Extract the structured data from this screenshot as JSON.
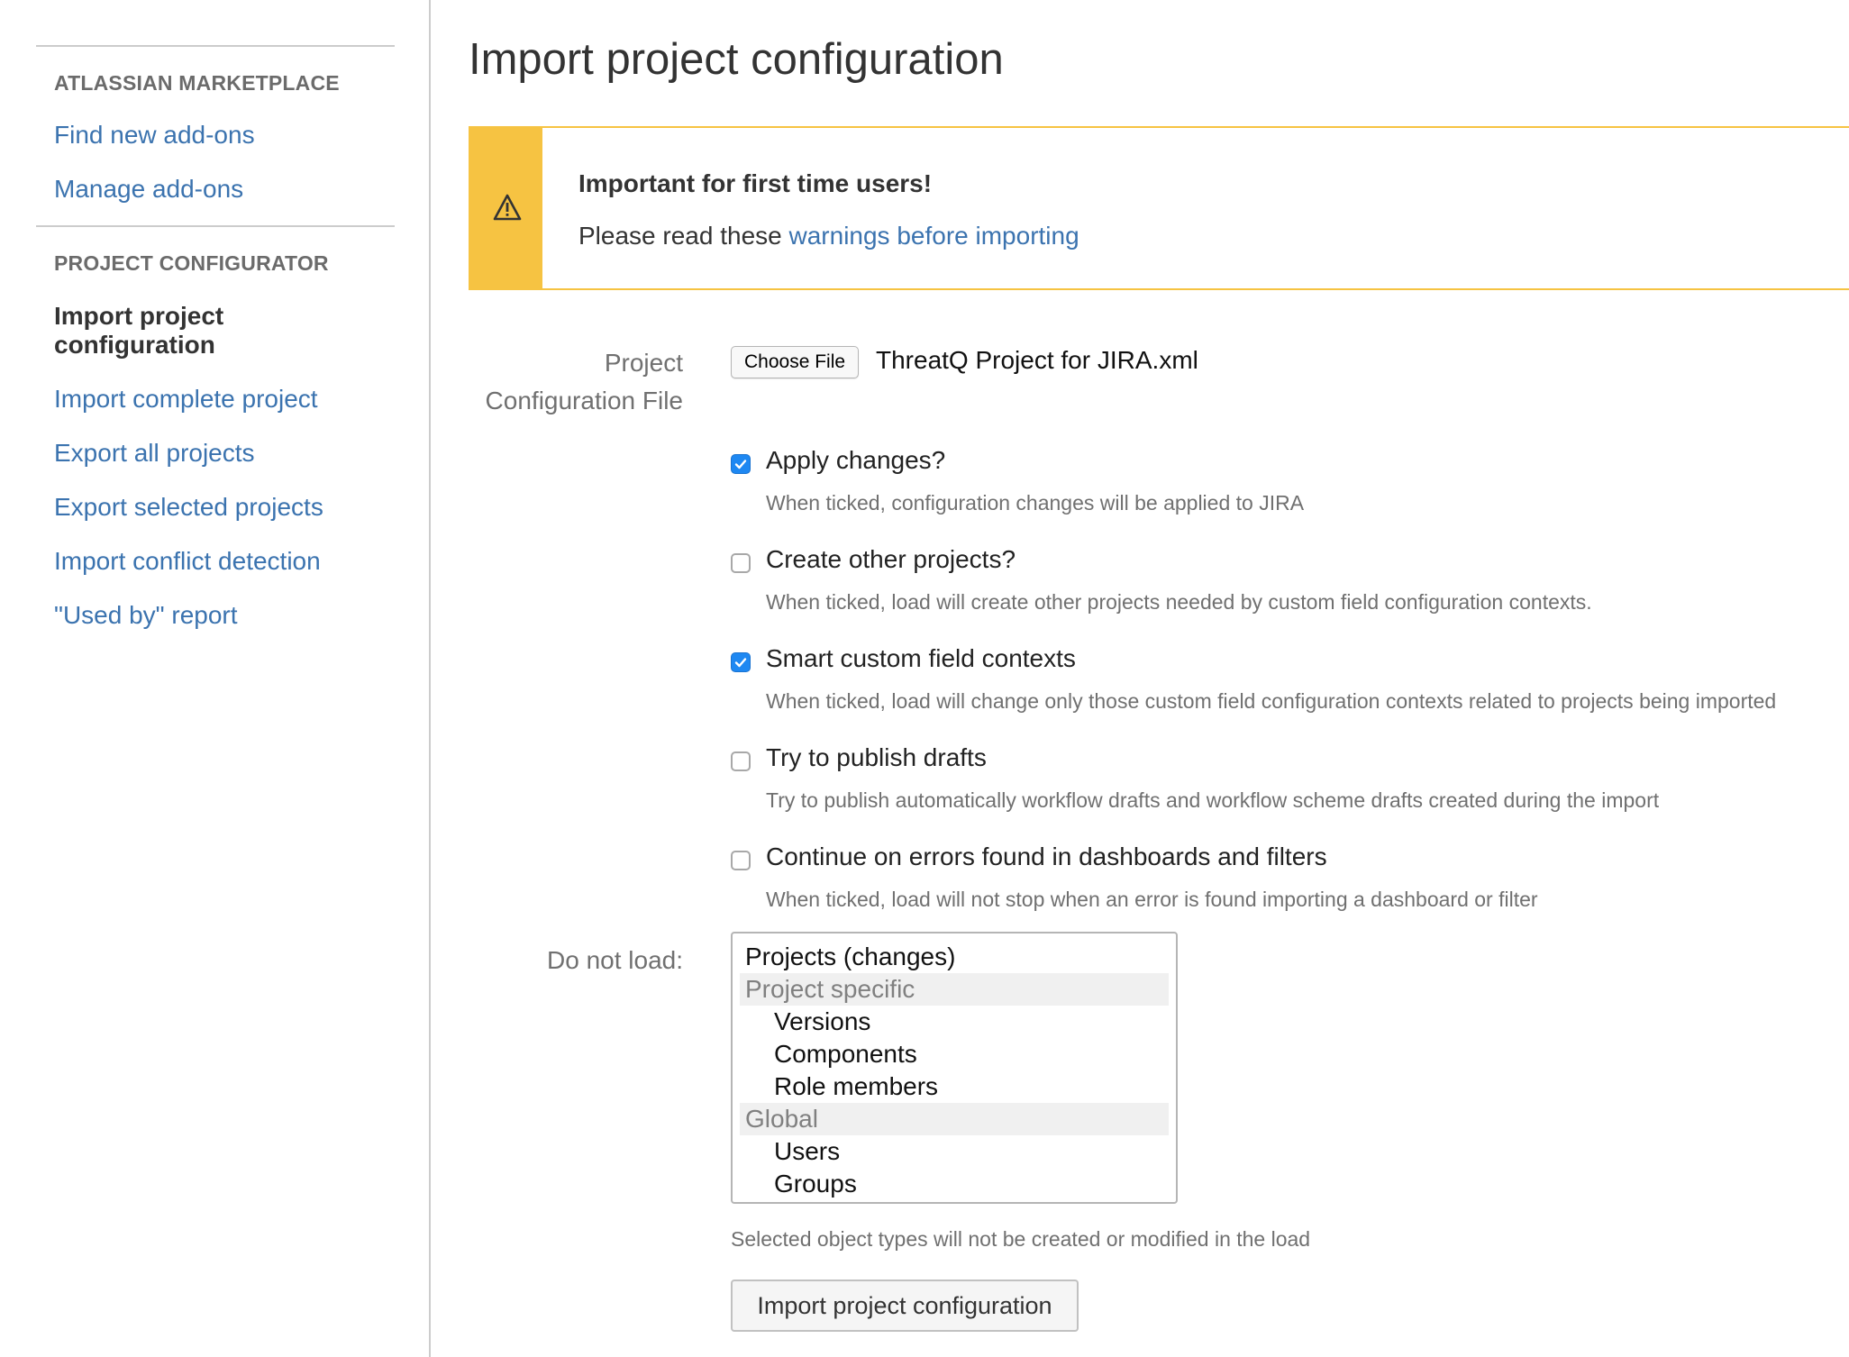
{
  "sidebar": {
    "sections": [
      {
        "heading": "ATLASSIAN MARKETPLACE"
      },
      {
        "heading": "PROJECT CONFIGURATOR"
      }
    ],
    "marketplace_links": [
      "Find new add-ons",
      "Manage add-ons"
    ],
    "current_item": "Import project configuration",
    "configurator_links": [
      "Import complete project",
      "Export all projects",
      "Export selected projects",
      "Import conflict detection",
      "\"Used by\" report"
    ]
  },
  "main": {
    "title": "Import project configuration",
    "warning": {
      "title": "Important for first time users!",
      "text": "Please read these ",
      "link": "warnings before importing",
      "icon": "warning-triangle-icon",
      "accent_color": "#f6c342"
    },
    "file_field": {
      "label_line1": "Project",
      "label_line2": "Configuration File",
      "button": "Choose File",
      "file_name": "ThreatQ Project for JIRA.xml"
    },
    "options": [
      {
        "label": "Apply changes?",
        "description": "When ticked, configuration changes will be applied to JIRA",
        "checked": true
      },
      {
        "label": "Create other projects?",
        "description": "When ticked, load will create other projects needed by custom field configuration contexts.",
        "checked": false
      },
      {
        "label": "Smart custom field contexts",
        "description": "When ticked, load will change only those custom field configuration contexts related to projects being imported",
        "checked": true
      },
      {
        "label": "Try to publish drafts",
        "description": "Try to publish automatically workflow drafts and workflow scheme drafts created during the import",
        "checked": false
      },
      {
        "label": "Continue on errors found in dashboards and filters",
        "description": "When ticked, load will not stop when an error is found importing a dashboard or filter",
        "checked": false
      }
    ],
    "do_not_load": {
      "label": "Do not load:",
      "items": {
        "projects_changes": "Projects (changes)",
        "project_specific": "Project specific",
        "versions": "Versions",
        "components": "Components",
        "role_members": "Role members",
        "global": "Global",
        "users": "Users",
        "groups": "Groups"
      },
      "help": "Selected object types will not be created or modified in the load"
    },
    "submit_button": "Import project configuration",
    "link_color": "#3b73af",
    "checkbox_color": "#1e88f2"
  }
}
